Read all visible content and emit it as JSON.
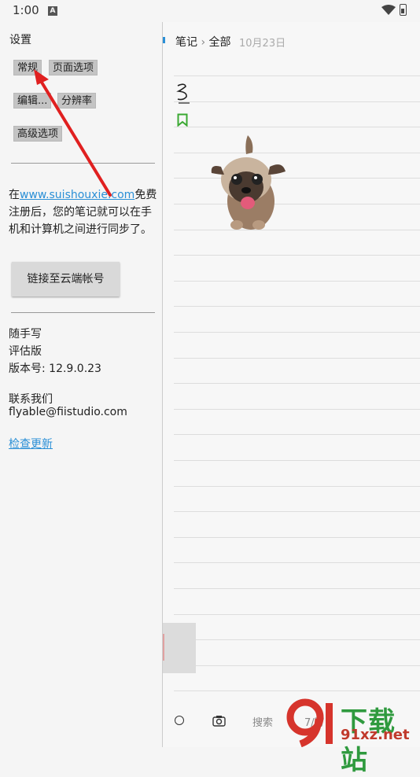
{
  "status_bar": {
    "time": "1:00",
    "notification_letter": "A"
  },
  "settings": {
    "title": "设置",
    "tabs": [
      "常规",
      "页面选项",
      "编辑...",
      "分辨率",
      "高级选项"
    ],
    "sync_prefix": "在",
    "sync_link": "www.suishouxie.com",
    "sync_suffix": "免费注册后，您的笔记就可以在手机和计算机之间进行同步了。",
    "link_button": "链接至云端帐号",
    "app_name": "随手写",
    "edition": "评估版",
    "version": "版本号: 12.9.0.23",
    "contact_title": "联系我们",
    "contact_email": "flyable@fiistudio.com",
    "check_update": "检查更新"
  },
  "notebook": {
    "breadcrumb_root": "笔记",
    "breadcrumb_separator": "›",
    "breadcrumb_current": "全部",
    "date": "10月23日",
    "handwriting": "3",
    "bottom_bar": {
      "search": "搜索",
      "draw": "7/写"
    }
  },
  "watermark": {
    "brand": "下载站",
    "url": "91xz.net"
  },
  "colors": {
    "link": "#2a8fd6",
    "bookmark": "#3aa832",
    "arrow": "#e02020",
    "tab_bg": "#c4c4c4"
  }
}
